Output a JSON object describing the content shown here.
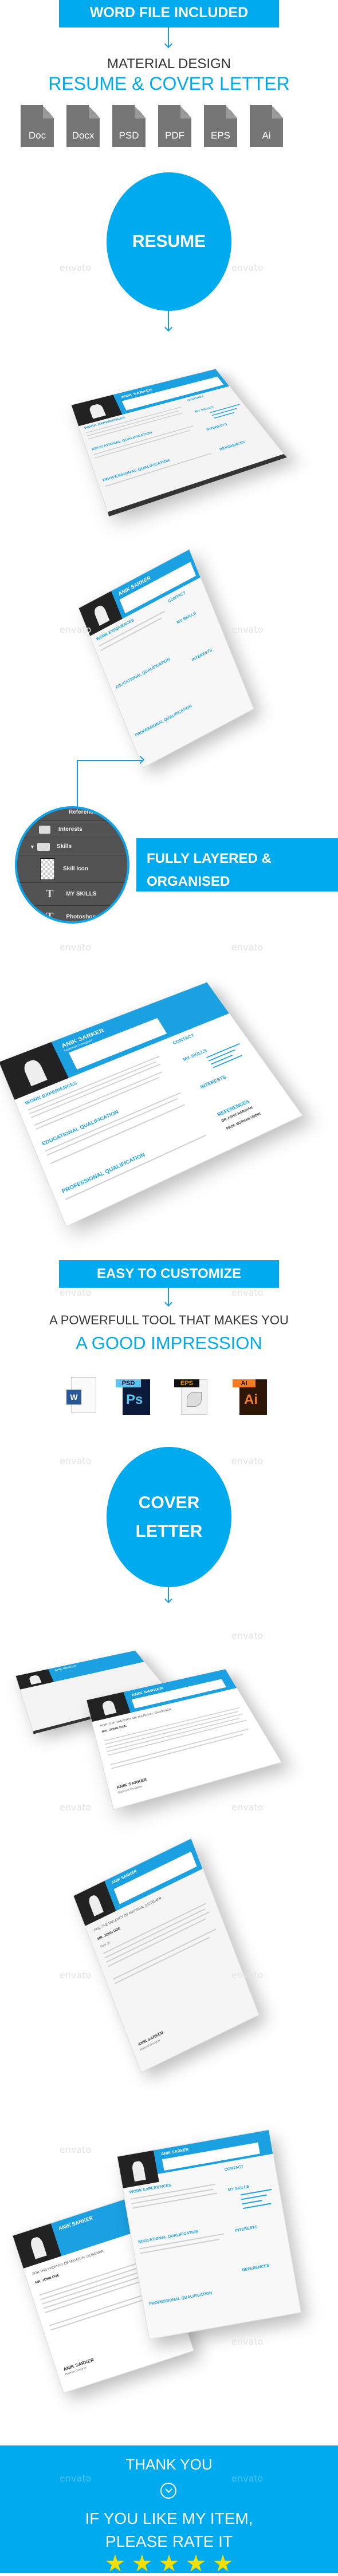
{
  "colors": {
    "accent": "#00aaee",
    "star": "#f1df00",
    "dark_panel": "#535353",
    "file_icon": "#757575"
  },
  "header": {
    "word_banner": "WORD FILE INCLUDED",
    "subtitle": "MATERIAL DESIGN",
    "title": "RESUME & COVER LETTER",
    "file_types": [
      "Doc",
      "Docx",
      "PSD",
      "PDF",
      "EPS",
      "Ai"
    ]
  },
  "resume_section": {
    "circle_label": "RESUME"
  },
  "resume_mock": {
    "name": "ANIK SARKER",
    "role": "Material Designer",
    "sections": [
      "WORK EXPERIENCES",
      "EDUCATIONAL QUALIFICATION",
      "PROFESSIONAL QUALIFICATION",
      "CONTACT",
      "MY SKILLS",
      "INTERESTS",
      "REFERENCES"
    ],
    "references": [
      "DR. ASHIT NARAYAN",
      "PROF. BORHAN UDDIN"
    ]
  },
  "layers_panel": {
    "rows": [
      "References",
      "Interests",
      "Skills",
      "Skill Icon",
      "MY SKILLS",
      "Photoshop"
    ],
    "banner_line1": "FULLY LAYERED &",
    "banner_line2": "ORGANISED"
  },
  "customize": {
    "banner": "EASY TO CUSTOMIZE",
    "line1": "A POWERFULL TOOL THAT MAKES YOU",
    "line2": "A GOOD IMPRESSION",
    "apps": [
      {
        "tag": "W",
        "name": "word-icon"
      },
      {
        "tag": "PSD",
        "glyph": "Ps",
        "name": "photoshop-icon"
      },
      {
        "tag": "EPS",
        "name": "eps-icon"
      },
      {
        "tag": "AI",
        "glyph": "Ai",
        "name": "illustrator-icon"
      }
    ]
  },
  "cover_section": {
    "circle_line1": "COVER",
    "circle_line2": "LETTER"
  },
  "cover_mock": {
    "vacancy": "FOR THE VACANCY OF MATERIAL DESIGNER",
    "recipient": "MR. JOHN DOE",
    "greeting": "Dear Sir,",
    "signature_name": "ANIK SARKER",
    "signature_role": "Material Designer"
  },
  "footer": {
    "thank_you": "THANK YOU",
    "line1": "IF YOU LIKE MY ITEM,",
    "line2": "PLEASE RATE IT",
    "rating": 5,
    "rating_max": 5
  },
  "watermark": "envato"
}
